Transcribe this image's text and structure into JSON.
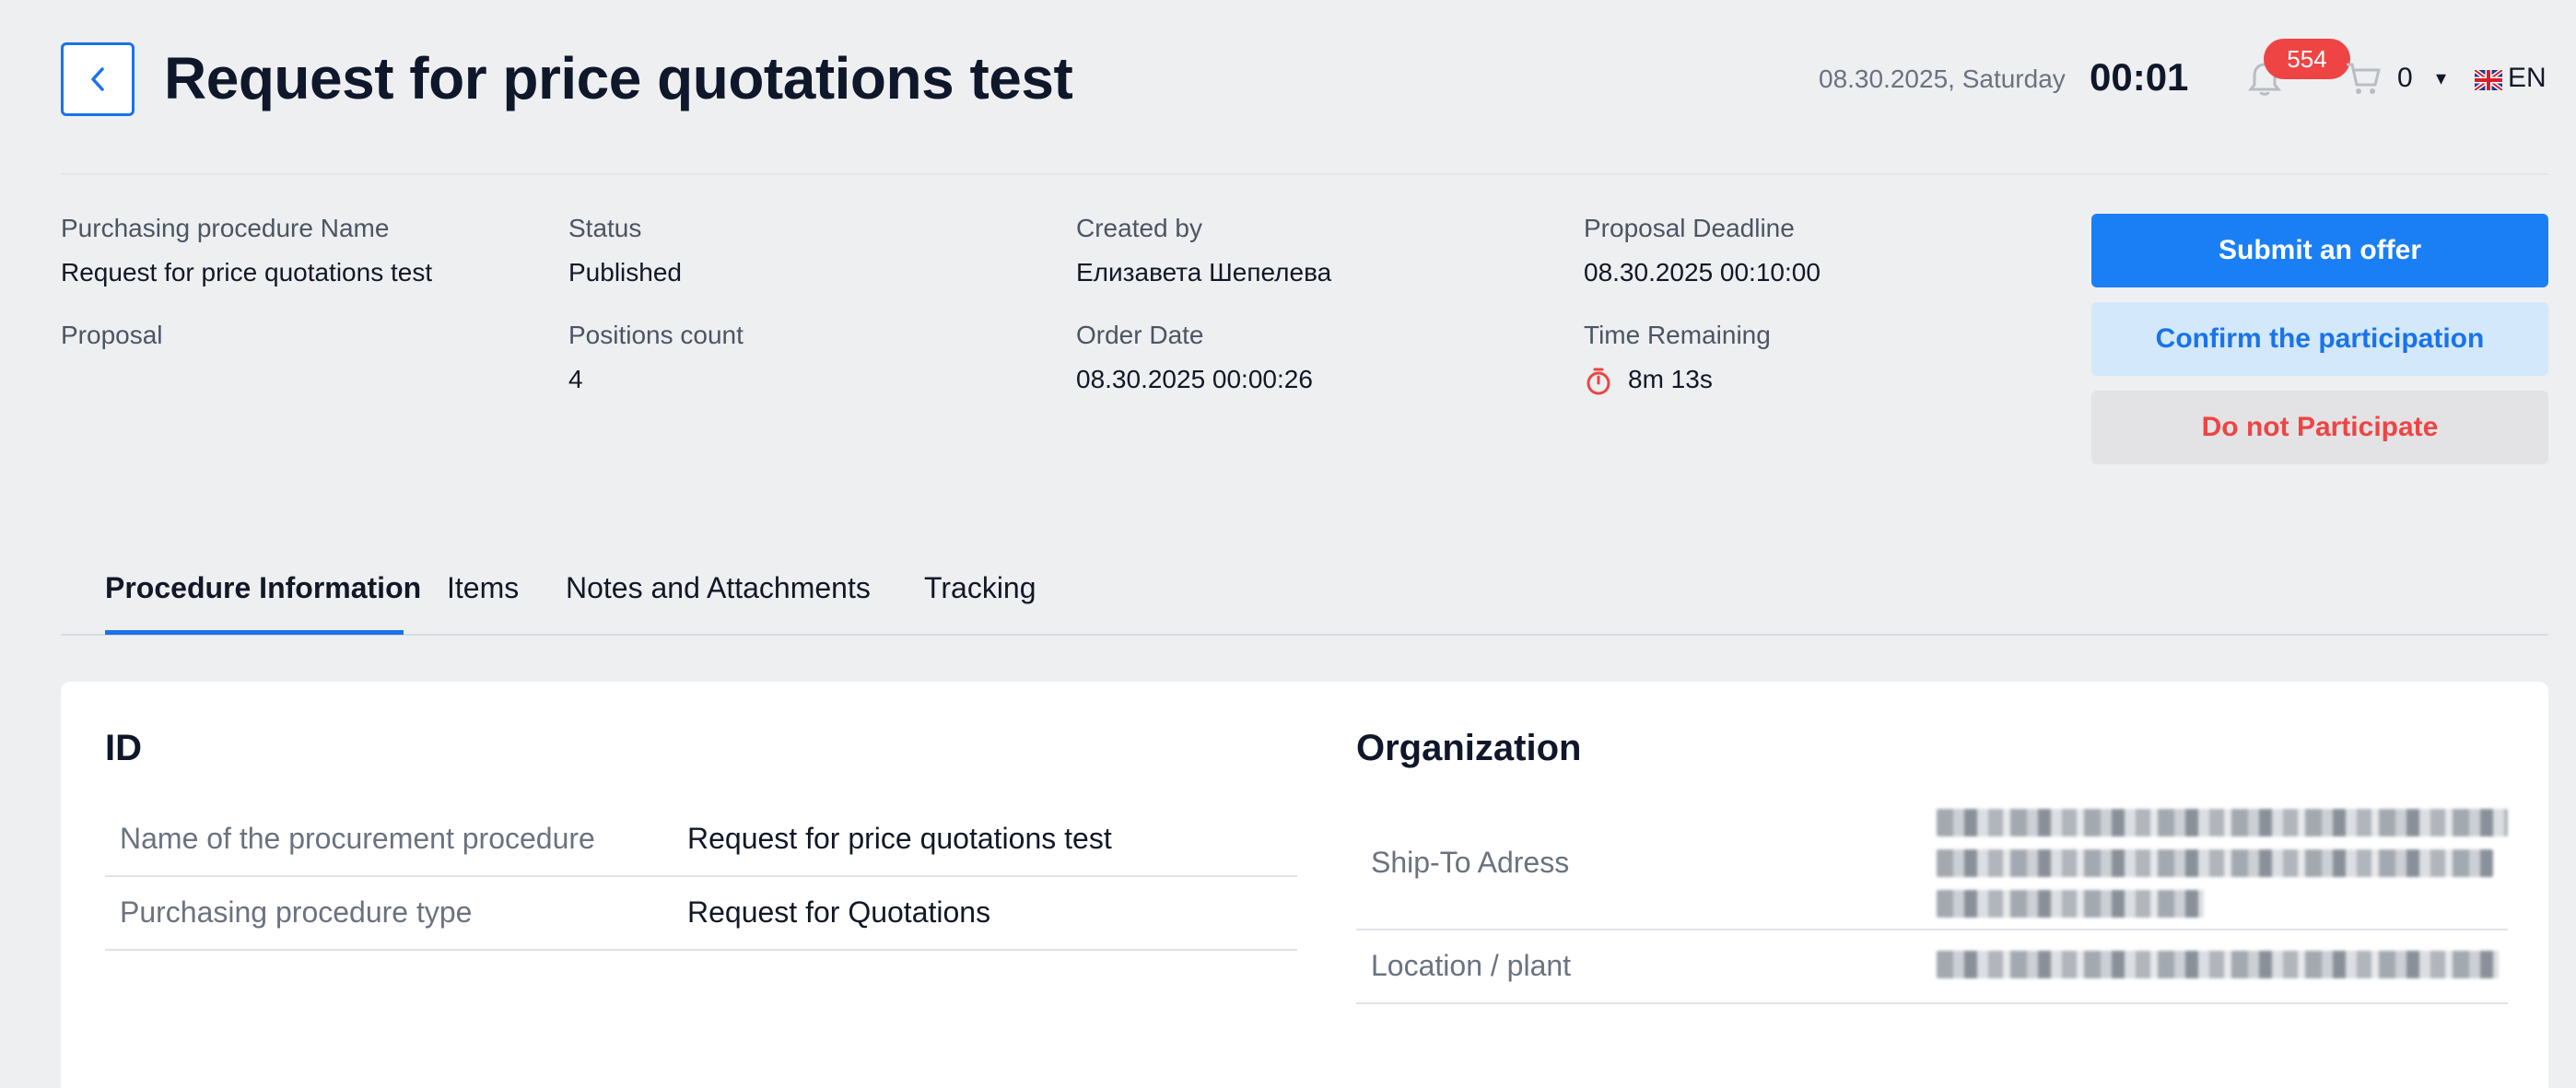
{
  "header": {
    "title": "Request for price quotations test",
    "date": "08.30.2025, Saturday",
    "time": "00:01",
    "notifications_count": "554",
    "cart_count": "0",
    "language": "EN"
  },
  "info": {
    "procedure_name_label": "Purchasing procedure Name",
    "procedure_name_value": "Request for price quotations test",
    "status_label": "Status",
    "status_value": "Published",
    "created_by_label": "Created by",
    "created_by_value": "Елизавета Шепелева",
    "deadline_label": "Proposal Deadline",
    "deadline_value": "08.30.2025 00:10:00",
    "proposal_label": "Proposal",
    "positions_label": "Positions count",
    "positions_value": "4",
    "order_date_label": "Order Date",
    "order_date_value": "08.30.2025 00:00:26",
    "time_remaining_label": "Time Remaining",
    "time_remaining_value": "8m 13s"
  },
  "actions": {
    "submit": "Submit an offer",
    "confirm": "Confirm the participation",
    "decline": "Do not Participate"
  },
  "tabs": [
    {
      "label": "Procedure Information",
      "active": true
    },
    {
      "label": "Items",
      "active": false
    },
    {
      "label": "Notes and Attachments",
      "active": false
    },
    {
      "label": "Tracking",
      "active": false
    }
  ],
  "id_section": {
    "title": "ID",
    "rows": [
      {
        "label": "Name of the procurement procedure",
        "value": "Request for price quotations test"
      },
      {
        "label": "Purchasing procedure type",
        "value": "Request for Quotations"
      }
    ]
  },
  "organization_section": {
    "title": "Organization",
    "rows": [
      {
        "label": "Ship-To Adress"
      },
      {
        "label": "Location / plant"
      }
    ]
  },
  "colors": {
    "accent": "#1a73e8",
    "danger": "#ef4444",
    "background": "#eeeff1"
  }
}
